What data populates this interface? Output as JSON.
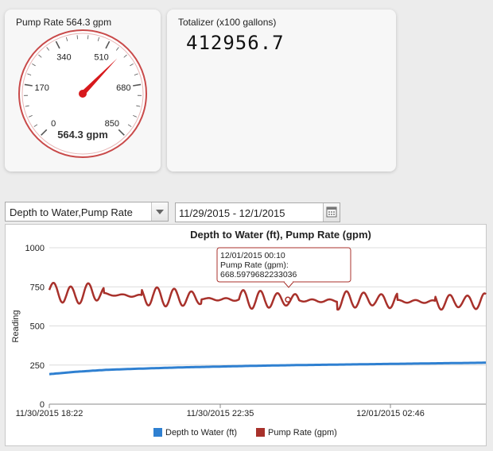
{
  "gauge": {
    "title": "Pump Rate 564.3 gpm",
    "value": 564.3,
    "readout": "564.3 gpm",
    "min": 0,
    "max": 850,
    "scale_labels": [
      "0",
      "170",
      "340",
      "510",
      "680",
      "850"
    ],
    "needle_color": "#d7191c",
    "ring_color": "#c94a4a"
  },
  "totalizer": {
    "title": "Totalizer (x100 gallons)",
    "value": "412956.7"
  },
  "controls": {
    "series_select_value": "Depth to Water,Pump Rate",
    "date_range": "11/29/2015 - 12/1/2015"
  },
  "tooltip": {
    "line1": "12/01/2015 00:10",
    "line2": "Pump Rate (gpm):",
    "line3": "668.5979682233036"
  },
  "chart_data": {
    "type": "line",
    "title": "Depth to Water (ft), Pump Rate (gpm)",
    "ylabel": "Reading",
    "ylim": [
      0,
      1000
    ],
    "yticks": [
      "0",
      "250",
      "500",
      "750",
      "1000"
    ],
    "xticks": [
      "11/30/2015 18:22",
      "11/30/2015 22:35",
      "12/01/2015 02:46"
    ],
    "grid": "horizontal",
    "legend_position": "bottom",
    "x_hours": [
      18.37,
      19.0,
      19.5,
      20.0,
      21.0,
      22.0,
      23.0,
      24.0,
      25.0,
      26.0,
      27.0,
      28.0,
      29.0,
      30.4
    ],
    "series": [
      {
        "name": "Depth to Water (ft)",
        "color": "#2f80d1",
        "values": [
          192,
          205,
          213,
          220,
          228,
          235,
          240,
          245,
          249,
          252,
          255,
          258,
          261,
          265
        ]
      },
      {
        "name": "Pump Rate (gpm)",
        "color": "#a8312b",
        "values": [
          730,
          690,
          720,
          700,
          690,
          680,
          670,
          669,
          665,
          660,
          670,
          658,
          655,
          655
        ],
        "oscillation_amplitude": 60
      }
    ],
    "highlight_point": {
      "x_label": "12/01/2015 00:10",
      "value": 668.5979682233036
    }
  }
}
